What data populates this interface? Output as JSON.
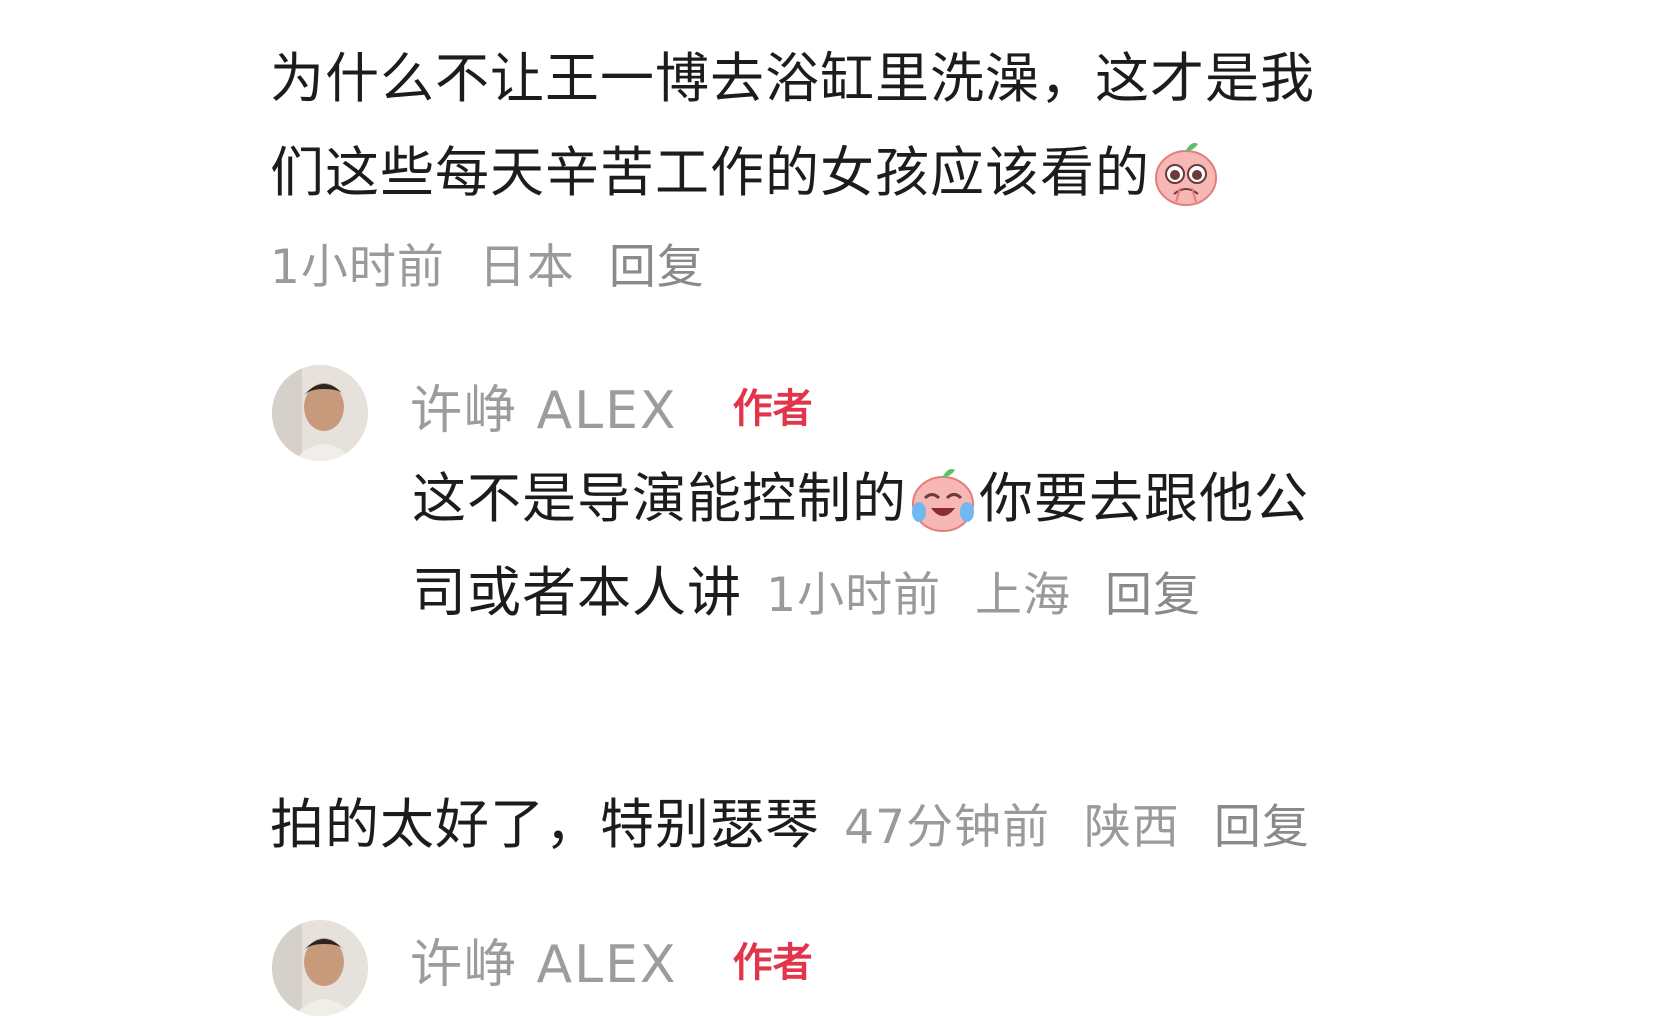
{
  "comments": [
    {
      "text_line1": "为什么不让王一博去浴缸里洗澡，这才是我",
      "text_line2": "们这些每天辛苦工作的女孩应该看的",
      "emoji": "pleading-face-icon",
      "time": "1小时前",
      "location": "日本",
      "reply_label": "回复",
      "reply": {
        "username": "许峥 ALEX",
        "author_tag": "作者",
        "text_part1": "这不是导演能控制的",
        "emoji": "crying-laughing-face-icon",
        "text_part2": "你要去跟他公",
        "text_line2": "司或者本人讲",
        "time": "1小时前",
        "location": "上海",
        "reply_label": "回复"
      }
    },
    {
      "text": "拍的太好了，特别瑟琴",
      "time": "47分钟前",
      "location": "陕西",
      "reply_label": "回复",
      "reply": {
        "username": "许峥 ALEX",
        "author_tag": "作者"
      }
    }
  ]
}
